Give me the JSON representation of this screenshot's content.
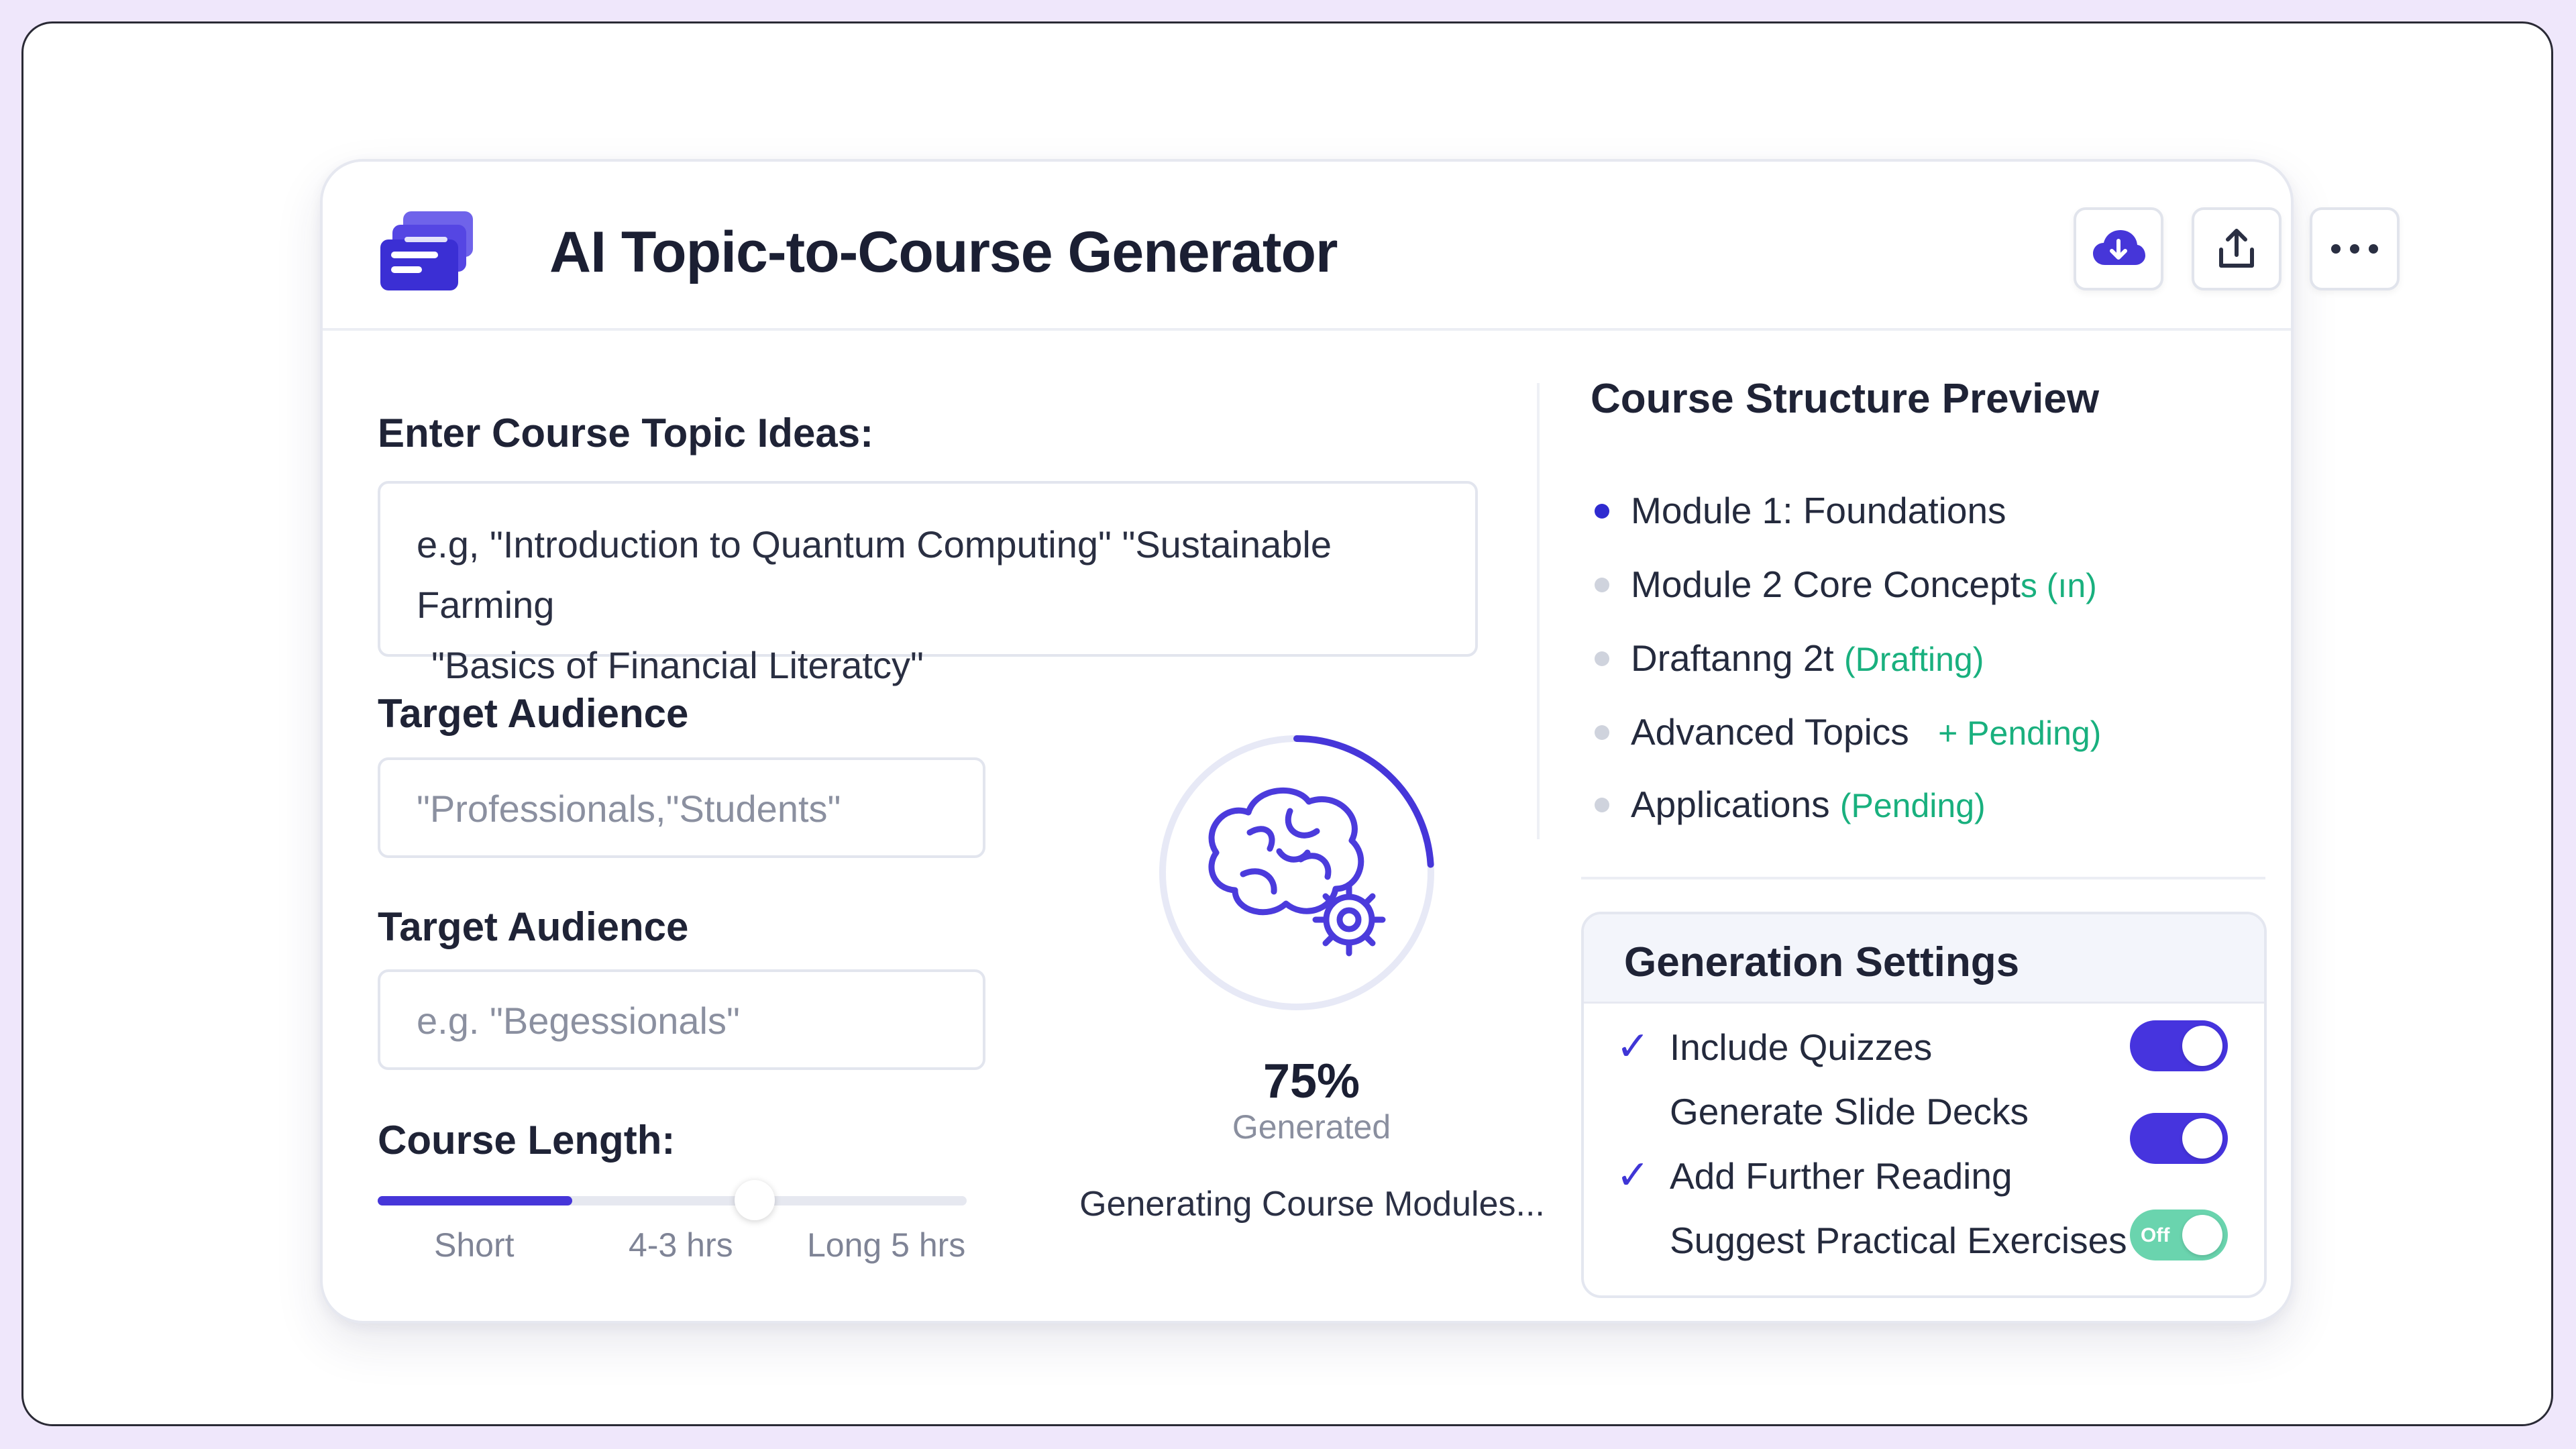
{
  "app": {
    "title": "AI Topic-to-Course Generator",
    "accent_color": "#4636d9"
  },
  "header_actions": [
    {
      "icon": "cloud-download-icon"
    },
    {
      "icon": "share-upload-icon"
    },
    {
      "icon": "more-horizontal-icon"
    }
  ],
  "form": {
    "topic_label": "Enter Course Topic Ideas:",
    "topic_value_line1": "e.g, \"Introduction to Quantum Computing\" \"Sustainable Farming",
    "topic_value_line2": "\"Basics of Financial Literatcy\"",
    "audience_label_1": "Target Audience",
    "audience_value_1": "\"Professionals,\"Students\"",
    "audience_label_2": "Target Audience",
    "audience_placeholder_2": "e.g. \"Begessionals\"",
    "length_label": "Course Length:",
    "length_ticks": [
      "Short",
      "4-3 hrs",
      "Long 5 hrs"
    ],
    "length_fill_fraction": 0.33,
    "length_knob_fraction": 0.64
  },
  "progress": {
    "percent": 75,
    "percent_text": "75%",
    "sub_label": "Generated",
    "status": "Generating Course Modules..."
  },
  "preview": {
    "title": "Course Structure Preview",
    "modules": [
      {
        "name": "Module 1: Foundations",
        "tag": "",
        "active": true
      },
      {
        "name": "Module 2 Core Concept",
        "tag": "s (ın)",
        "active": false
      },
      {
        "name": "Draftanng 2t",
        "tag": "(Drafting)",
        "active": false
      },
      {
        "name": "Advanced Topics",
        "tag": "+ Pending)",
        "active": false
      },
      {
        "name": "Applications",
        "tag": "(Pending)",
        "active": false
      }
    ]
  },
  "settings": {
    "title": "Generation Settings",
    "items": [
      {
        "label": "Include Quizzes",
        "checked": true
      },
      {
        "label": "Generate Slide Decks",
        "checked": false
      },
      {
        "label": "Add Further Reading",
        "checked": true
      },
      {
        "label": "Suggest Practical Exercises",
        "checked": false
      }
    ],
    "toggles": [
      {
        "state": "on"
      },
      {
        "state": "on"
      },
      {
        "state": "off",
        "text": "Off"
      }
    ]
  }
}
